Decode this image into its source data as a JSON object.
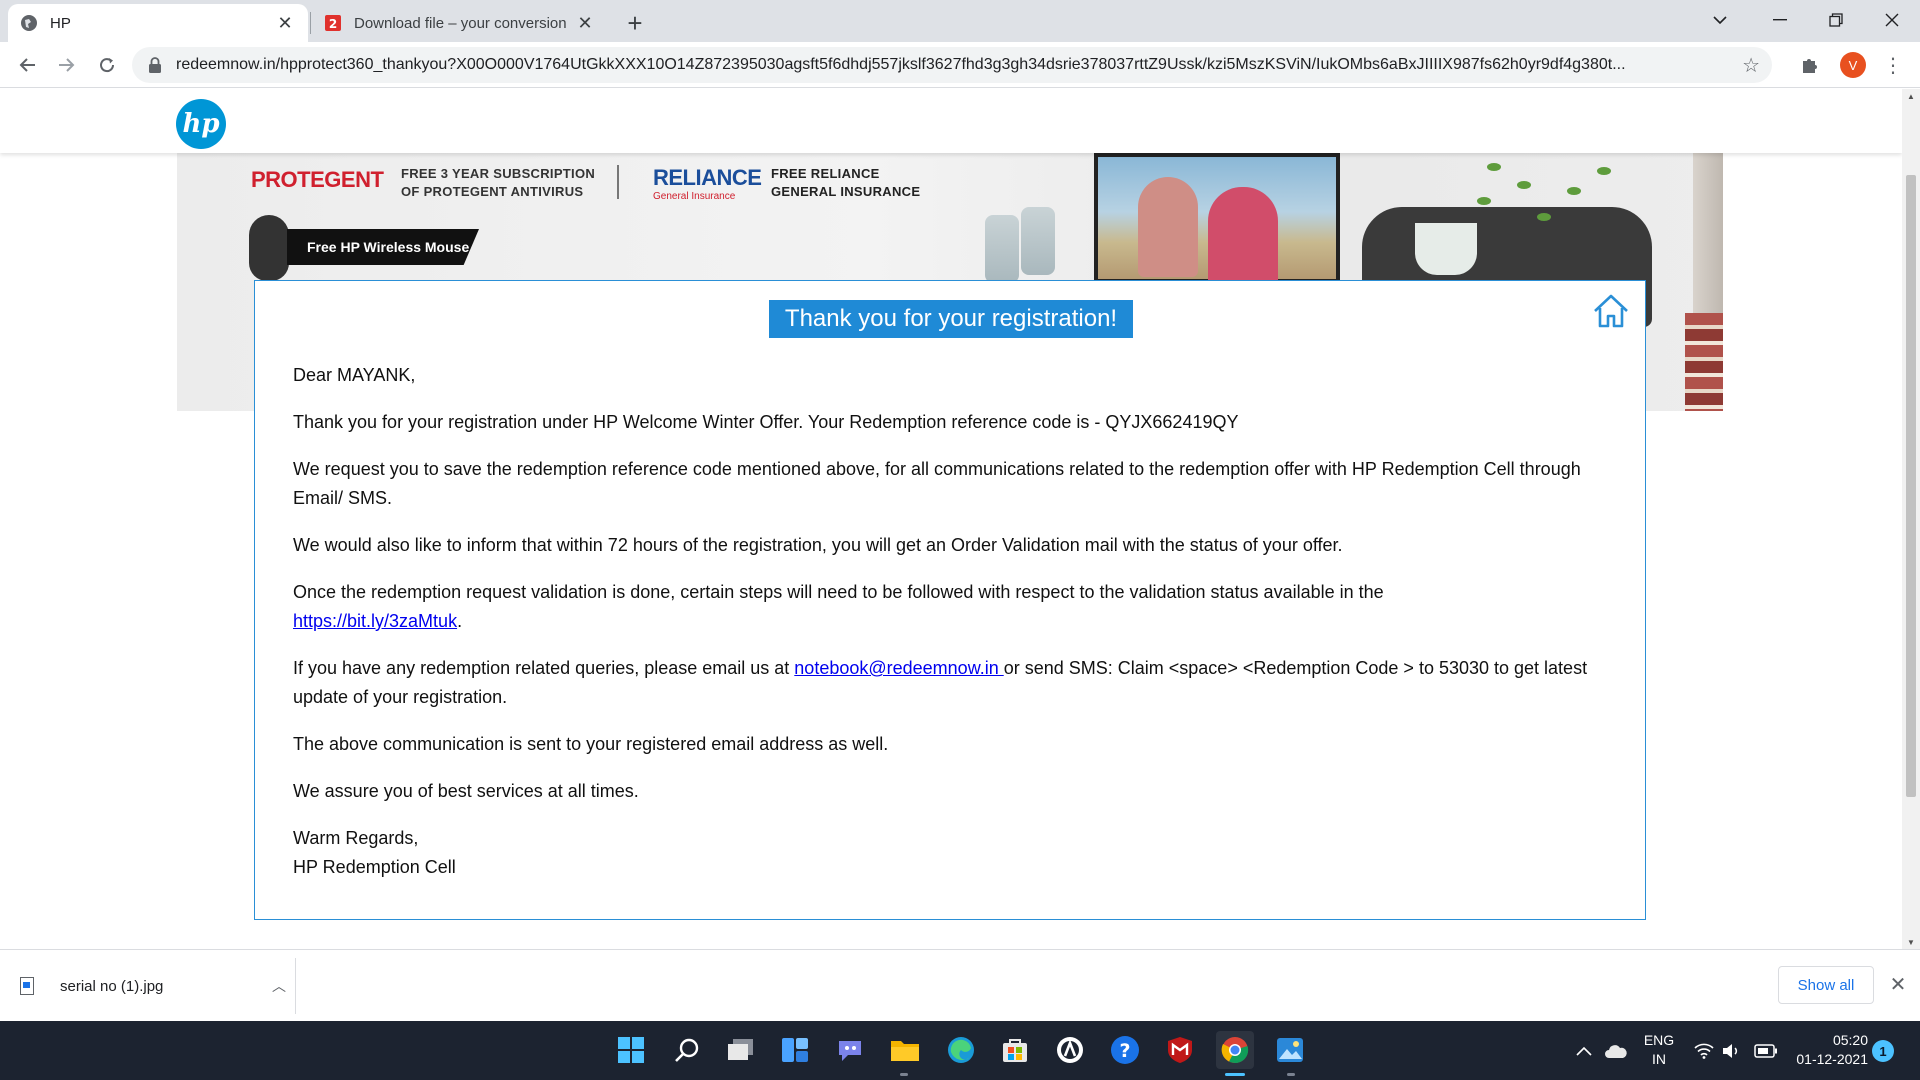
{
  "browser": {
    "tabs": [
      {
        "title": "HP",
        "icon": "globe-icon",
        "active": true
      },
      {
        "title": "Download file – your conversion",
        "icon": "pdf-app-icon",
        "active": false
      }
    ],
    "url": "redeemnow.in/hpprotect360_thankyou?X00O000V1764UtGkkXXX10O14Z872395030agsft5f6dhdj557jkslf3627fhd3g3gh34dsrie378037rttZ9Ussk/kzi5MszKSViN/IukOMbs6aBxJIIIIX987fs62h0yr9df4g380t...",
    "profile_initial": "V"
  },
  "page": {
    "logo_text": "hp",
    "banner": {
      "protegent_logo": "PROTEGENT",
      "protegent_line1": "FREE 3 YEAR SUBSCRIPTION",
      "protegent_line2": "OF PROTEGENT ANTIVIRUS",
      "reliance_logo": "RELIANCE",
      "reliance_sub": "General Insurance",
      "reliance_line1": "FREE RELIANCE",
      "reliance_line2": "GENERAL INSURANCE",
      "mouse_tag": "Free HP Wireless Mouse"
    },
    "card": {
      "title": "Thank you for your registration!",
      "greeting": "Dear MAYANK,",
      "p1": "Thank you for your registration under HP Welcome Winter Offer. Your Redemption reference code is - QYJX662419QY",
      "p2": "We request you to save the redemption reference code mentioned above, for all communications related to the redemption offer with HP Redemption Cell through Email/ SMS.",
      "p3": "We would also like to inform that within 72 hours of the registration, you will get an Order Validation mail with the status of your offer.",
      "p4_text": "Once the redemption request validation is done, certain steps will need to be followed with respect to the validation status available in the",
      "p4_link": "https://bit.ly/3zaMtuk",
      "p5_before": "If you have any redemption related queries, please email us at ",
      "p5_link": "notebook@redeemnow.in ",
      "p5_after": "or send SMS: Claim <space> <Redemption Code > to 53030 to get latest update of your registration.",
      "p6": "The above communication is sent to your registered email address as well.",
      "p7": "We assure you of best services at all times.",
      "closing": "Warm Regards,",
      "signature": "HP Redemption Cell"
    }
  },
  "downloads": {
    "file_name": "serial no (1).jpg",
    "show_all": "Show all"
  },
  "taskbar": {
    "apps": [
      "start-icon",
      "search-icon",
      "task-view-icon",
      "widgets-icon",
      "chat-icon",
      "file-explorer-icon",
      "edge-icon",
      "store-icon",
      "app-icon",
      "help-icon",
      "mcafee-icon",
      "chrome-icon",
      "photos-icon"
    ],
    "lang_top": "ENG",
    "lang_bottom": "IN",
    "time": "05:20",
    "date": "01-12-2021",
    "notifications": "1"
  },
  "colors": {
    "accent_blue": "#1f8ad6",
    "hp_blue": "#0096d6",
    "taskbar": "#1c2330"
  }
}
